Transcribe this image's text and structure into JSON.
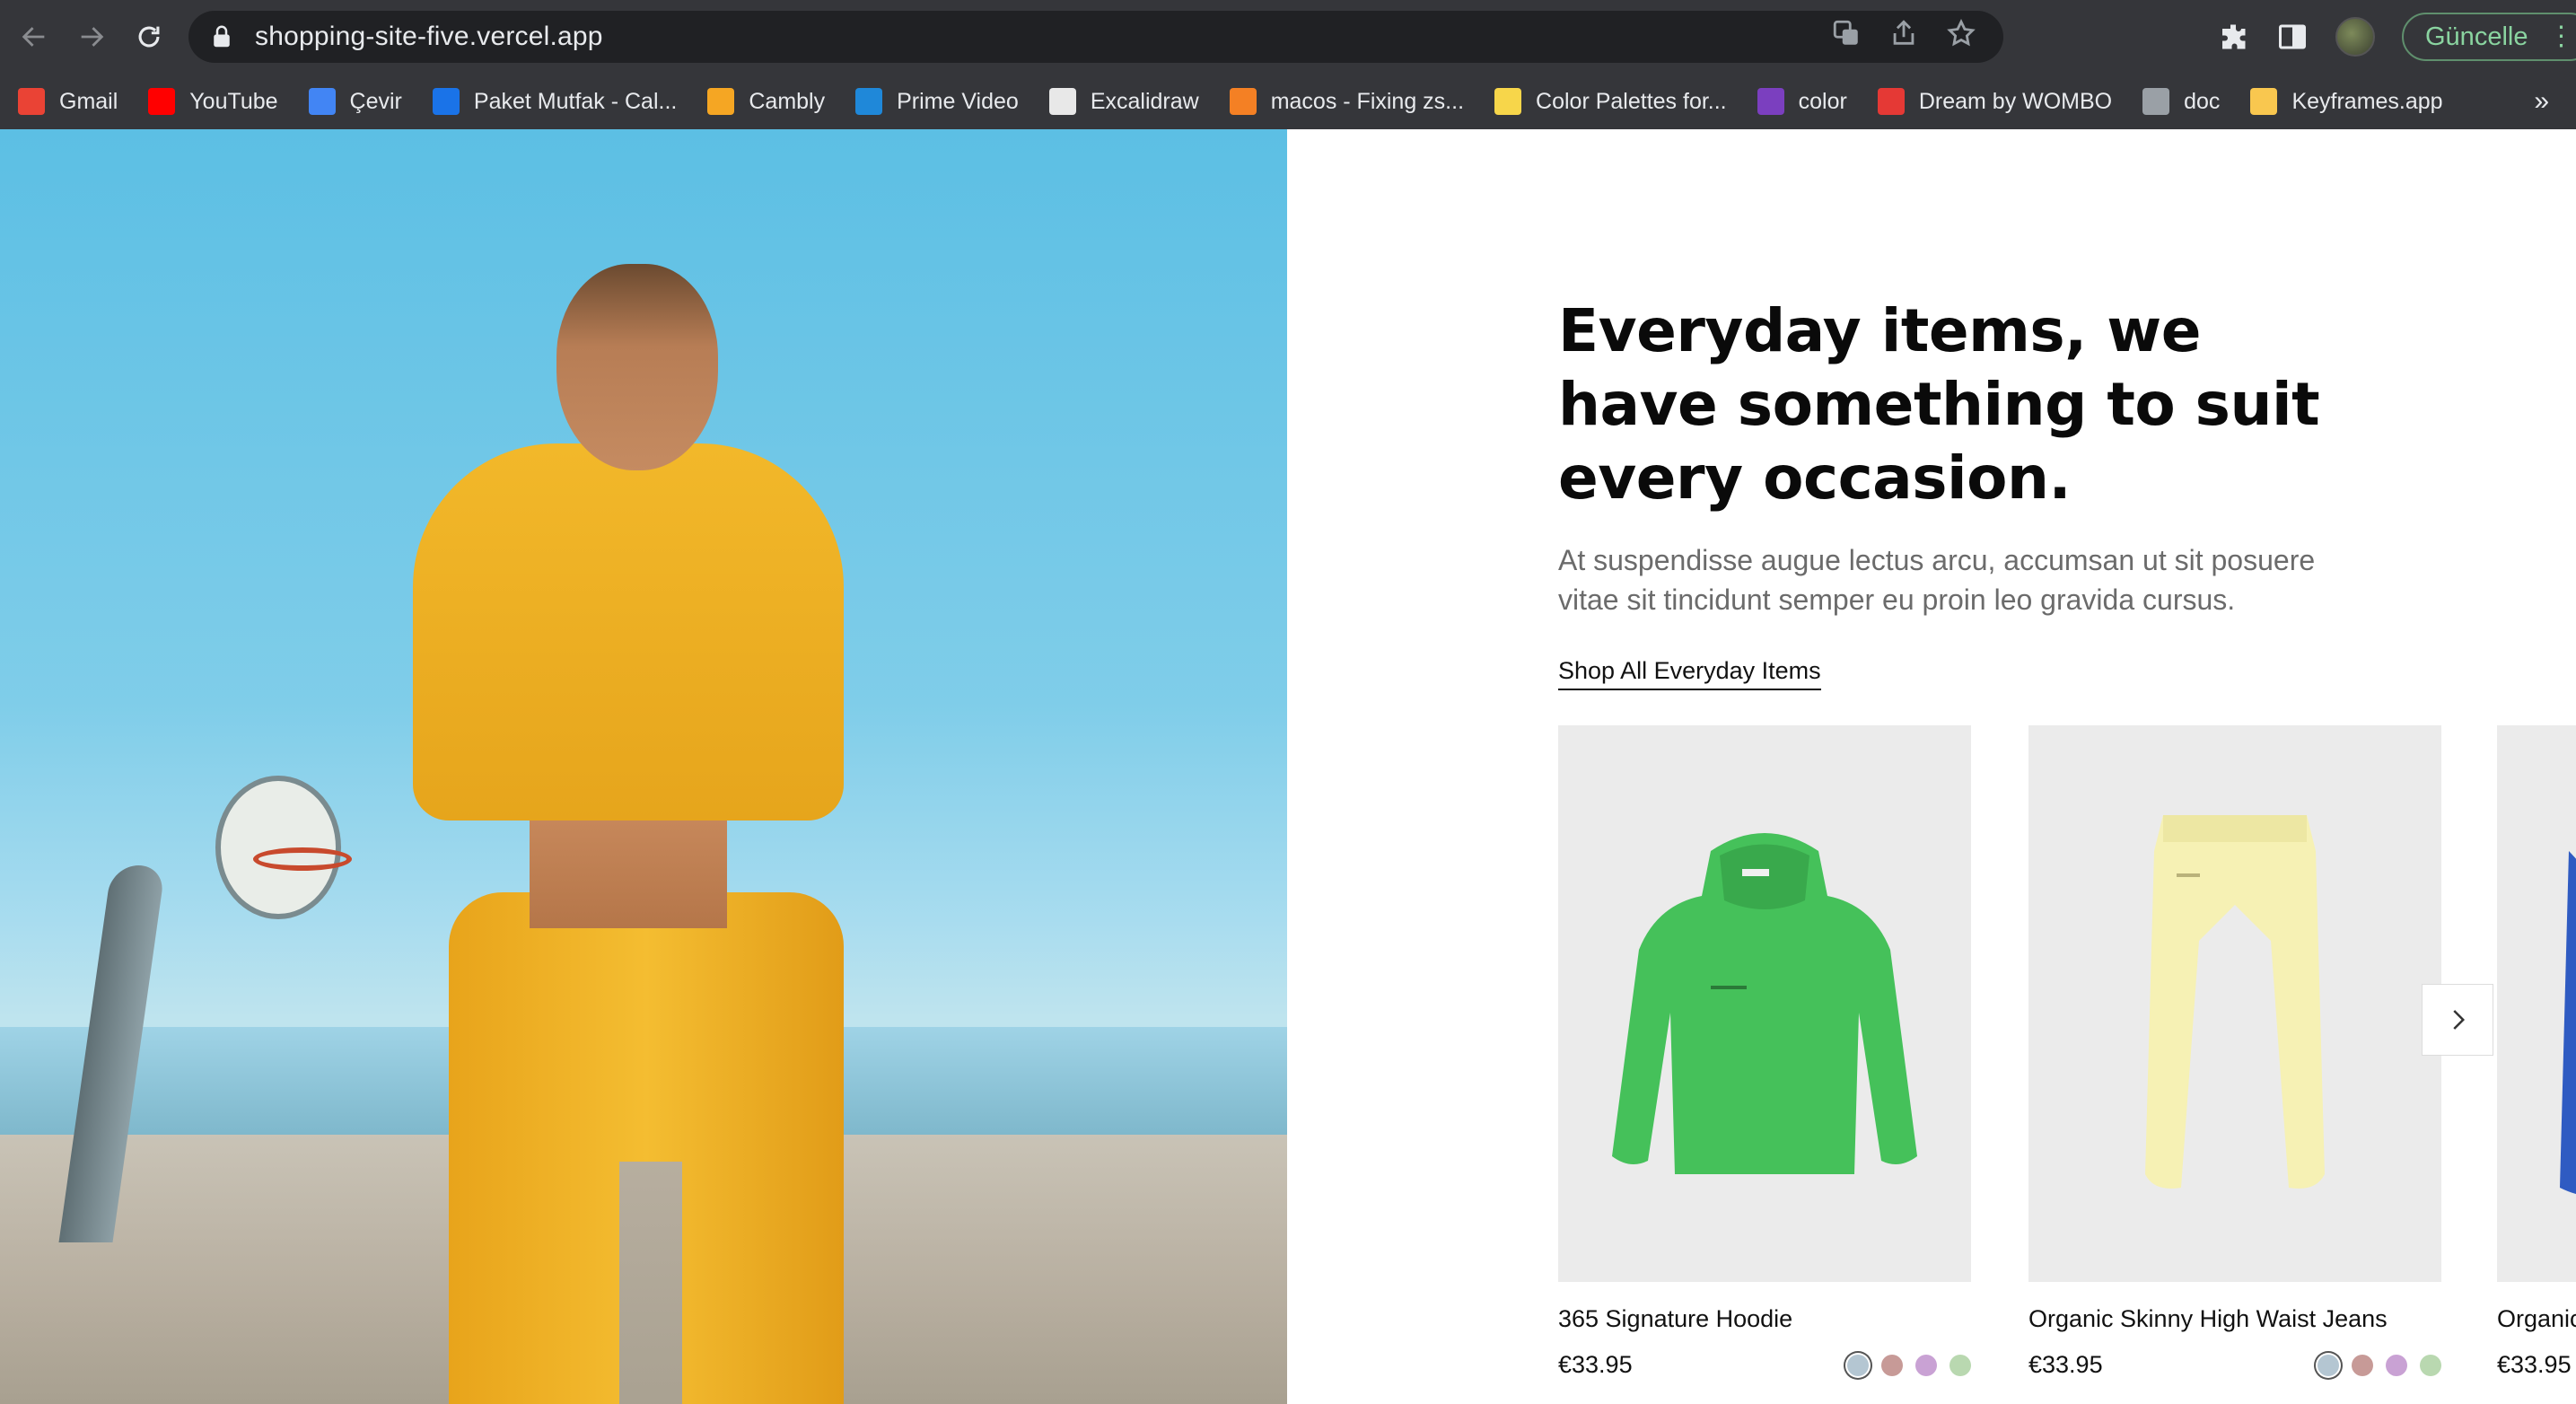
{
  "browser": {
    "url": "shopping-site-five.vercel.app",
    "update_label": "Güncelle",
    "bookmarks": [
      {
        "label": "Gmail",
        "icon": "gmail-icon",
        "color": "#ea4335"
      },
      {
        "label": "YouTube",
        "icon": "youtube-icon",
        "color": "#ff0000"
      },
      {
        "label": "Çevir",
        "icon": "translate-icon",
        "color": "#4285f4"
      },
      {
        "label": "Paket Mutfak - Cal...",
        "icon": "calendar-icon",
        "color": "#1a73e8"
      },
      {
        "label": "Cambly",
        "icon": "cambly-icon",
        "color": "#f5a623"
      },
      {
        "label": "Prime Video",
        "icon": "prime-video-icon",
        "color": "#1f88d9"
      },
      {
        "label": "Excalidraw",
        "icon": "excalidraw-icon",
        "color": "#e8e8e8"
      },
      {
        "label": "macos - Fixing zs...",
        "icon": "stackoverflow-icon",
        "color": "#f48024"
      },
      {
        "label": "Color Palettes for...",
        "icon": "palette-icon",
        "color": "#f7d64a"
      },
      {
        "label": "color",
        "icon": "color-drop-icon",
        "color": "#7b3fbf"
      },
      {
        "label": "Dream by WOMBO",
        "icon": "wombo-icon",
        "color": "#e53935"
      },
      {
        "label": "doc",
        "icon": "folder-icon",
        "color": "#9aa0a6"
      },
      {
        "label": "Keyframes.app",
        "icon": "keyframes-icon",
        "color": "#f9c74f"
      }
    ],
    "more_label": "»"
  },
  "hero": {
    "image": "woman-yellow-tracksuit-basketball-court-photo"
  },
  "section": {
    "heading": "Everyday items, we have something to suit every occasion.",
    "lead": "At suspendisse augue lectus arcu, accumsan ut sit posuere vitae sit tincidunt semper eu proin leo gravida cursus.",
    "shop_link": "Shop All Everyday Items"
  },
  "products": [
    {
      "name": "365 Signature Hoodie",
      "price": "€33.95",
      "image": "green-hoodie",
      "swatches": [
        "#b4c6d2",
        "#c79a97",
        "#c9a2d4",
        "#b9d8b0"
      ],
      "selected_swatch": 0
    },
    {
      "name": "Organic Skinny High Waist Jeans",
      "price": "€33.95",
      "image": "pale-yellow-sweatpants",
      "swatches": [
        "#b4c6d2",
        "#c79a97",
        "#c9a2d4",
        "#b9d8b0"
      ],
      "selected_swatch": 0
    },
    {
      "name": "Organic",
      "price": "€33.95",
      "image": "blue-garment-partial"
    }
  ],
  "carousel": {
    "next_icon": "chevron-right-icon"
  }
}
